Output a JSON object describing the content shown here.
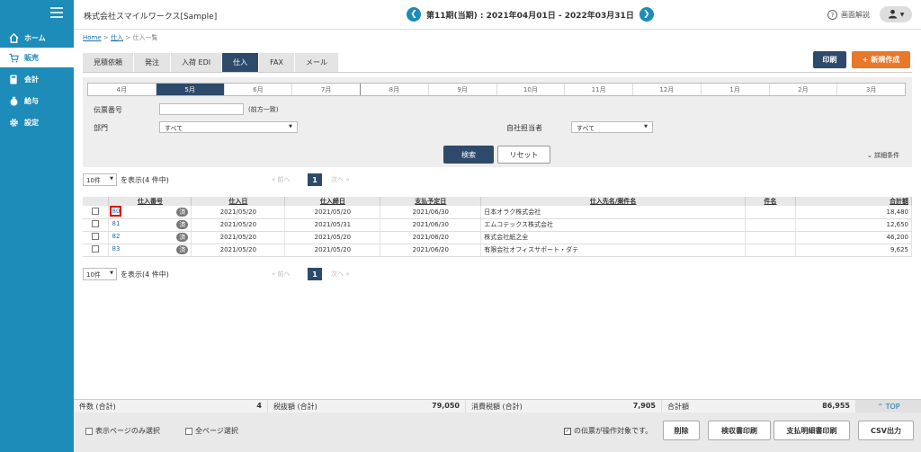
{
  "sidebar": {
    "items": [
      {
        "label": "ホーム",
        "icon": "home-icon"
      },
      {
        "label": "販売",
        "icon": "cart-icon"
      },
      {
        "label": "会計",
        "icon": "calculator-icon"
      },
      {
        "label": "給与",
        "icon": "money-bag-icon"
      },
      {
        "label": "設定",
        "icon": "gear-icon"
      }
    ]
  },
  "header": {
    "company": "株式会社スマイルワークス[Sample]",
    "period": "第11期(当期) : 2021年04月01日 - 2022年03月31日",
    "help": "画面解説"
  },
  "breadcrumb": {
    "home": "Home",
    "sep": " > ",
    "purchase": "仕入",
    "current": "仕入一覧"
  },
  "tabs": [
    "見積依頼",
    "発注",
    "入荷 EDI",
    "仕入",
    "FAX",
    "メール"
  ],
  "actions": {
    "print": "印刷",
    "new": "+ 新規作成"
  },
  "months": [
    "4月",
    "5月",
    "6月",
    "7月",
    "8月",
    "9月",
    "10月",
    "11月",
    "12月",
    "1月",
    "2月",
    "3月"
  ],
  "filter": {
    "slip_label": "伝票番号",
    "prefix_note": "(前方一致)",
    "dept_label": "部門",
    "dept_value": "すべて",
    "staff_label": "自社担当者",
    "staff_value": "すべて",
    "search": "検索",
    "reset": "リセット",
    "detail": "詳細条件"
  },
  "pager": {
    "per_page": "10件",
    "display": "を表示(4 件中)",
    "prev": "«  前へ",
    "page": "1",
    "next": "次へ  »"
  },
  "table": {
    "headers": [
      "仕入番号",
      "仕入日",
      "仕入締日",
      "支払予定日",
      "仕入先名/案件名",
      "件名",
      "合計額"
    ],
    "rows": [
      {
        "no": "80",
        "badge": "済",
        "date": "2021/05/20",
        "close": "2021/05/20",
        "pay": "2021/06/30",
        "vendor": "日本オラク株式会社",
        "subject": "",
        "total": "18,480"
      },
      {
        "no": "81",
        "badge": "済",
        "date": "2021/05/20",
        "close": "2021/05/31",
        "pay": "2021/06/30",
        "vendor": "エムコテックス株式会社",
        "subject": "",
        "total": "12,650"
      },
      {
        "no": "82",
        "badge": "済",
        "date": "2021/05/20",
        "close": "2021/05/20",
        "pay": "2021/06/20",
        "vendor": "株式会社紙之全",
        "subject": "",
        "total": "46,200"
      },
      {
        "no": "83",
        "badge": "済",
        "date": "2021/05/20",
        "close": "2021/05/20",
        "pay": "2021/06/20",
        "vendor": "有限会社オフィスサポート・ダテ",
        "subject": "",
        "total": "9,625"
      }
    ]
  },
  "summary": {
    "count_label": "件数 (合計)",
    "count": "4",
    "net_label": "税抜額 (合計)",
    "net": "79,050",
    "tax_label": "消費税額 (合計)",
    "tax": "7,905",
    "total_label": "合計額",
    "total": "86,955",
    "top": "TOP"
  },
  "footer": {
    "page_only": "表示ページのみ選択",
    "all_pages": "全ページ選択",
    "note": "の伝票が操作対象です。",
    "delete": "削除",
    "receipt": "検収書印刷",
    "statement": "支払明細書印刷",
    "csv": "CSV出力"
  }
}
